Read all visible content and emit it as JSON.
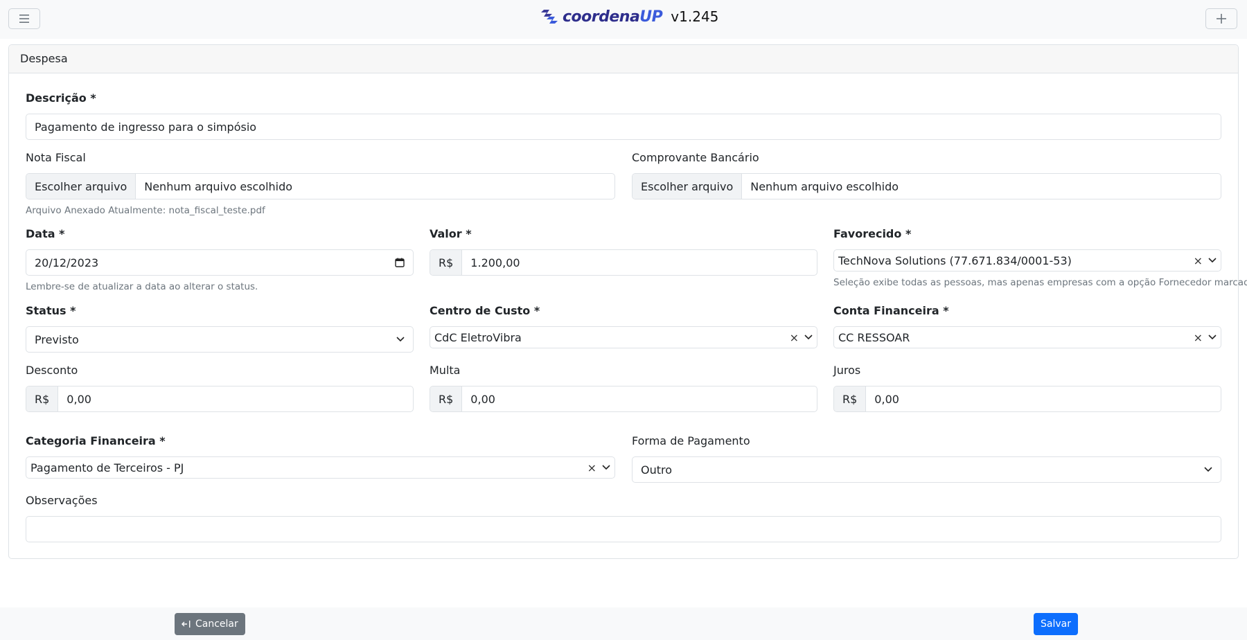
{
  "app": {
    "brand_prefix": "coordena",
    "brand_suffix": "UP",
    "version": "v1.245"
  },
  "card": {
    "title": "Despesa"
  },
  "form": {
    "descricao": {
      "label": "Descrição *",
      "value": "Pagamento de ingresso para o simpósio"
    },
    "nota_fiscal": {
      "label": "Nota Fiscal",
      "button": "Escolher arquivo",
      "file": "Nenhum arquivo escolhido",
      "hint": "Arquivo Anexado Atualmente: nota_fiscal_teste.pdf"
    },
    "comprovante": {
      "label": "Comprovante Bancário",
      "button": "Escolher arquivo",
      "file": "Nenhum arquivo escolhido"
    },
    "data": {
      "label": "Data *",
      "value": "20/12/2023",
      "hint": "Lembre-se de atualizar a data ao alterar o status."
    },
    "valor": {
      "label": "Valor *",
      "prefix": "R$",
      "value": "1.200,00"
    },
    "favorecido": {
      "label": "Favorecido *",
      "value": "TechNova Solutions (77.671.834/0001-53)",
      "hint": "Seleção exibe todas as pessoas, mas apenas empresas com a opção Fornecedor marcado"
    },
    "status": {
      "label": "Status *",
      "value": "Previsto"
    },
    "centro_custo": {
      "label": "Centro de Custo *",
      "value": "CdC EletroVibra"
    },
    "conta_financeira": {
      "label": "Conta Financeira *",
      "value": "CC RESSOAR"
    },
    "desconto": {
      "label": "Desconto",
      "prefix": "R$",
      "value": "0,00"
    },
    "multa": {
      "label": "Multa",
      "prefix": "R$",
      "value": "0,00"
    },
    "juros": {
      "label": "Juros",
      "prefix": "R$",
      "value": "0,00"
    },
    "categoria": {
      "label": "Categoria Financeira *",
      "value": "Pagamento de Terceiros - PJ"
    },
    "forma_pagamento": {
      "label": "Forma de Pagamento",
      "value": "Outro"
    },
    "observacoes": {
      "label": "Observações",
      "value": ""
    }
  },
  "footer": {
    "cancel_label": "Cancelar",
    "save_label": "Salvar"
  },
  "colors": {
    "primary": "#0d6efd",
    "secondary": "#6c757d",
    "brand": "#2e2e8c"
  }
}
